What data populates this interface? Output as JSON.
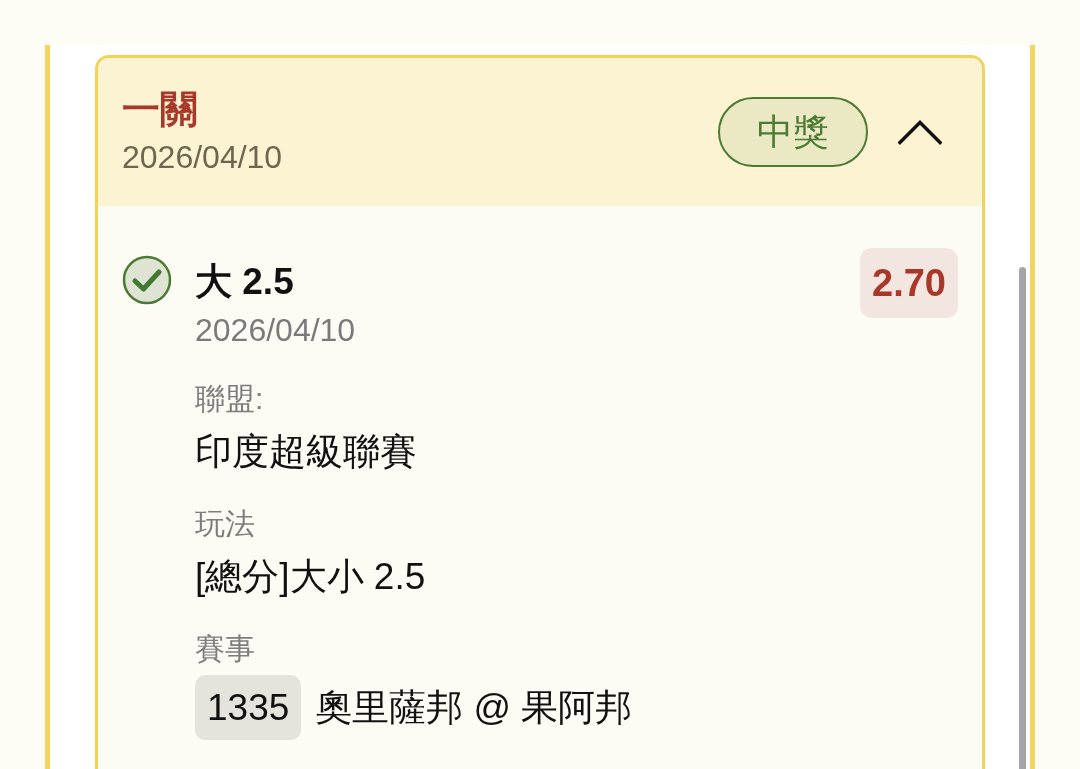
{
  "bet_card": {
    "title": "一關",
    "date": "2026/04/10",
    "status": "中獎",
    "expanded": true,
    "selections": [
      {
        "won": true,
        "pick": "大 2.5",
        "date": "2026/04/10",
        "odds": "2.70",
        "fields": [
          {
            "kind": "text",
            "label": "聯盟:",
            "value": "印度超級聯賽"
          },
          {
            "kind": "text",
            "label": "玩法",
            "value": "[總分]大小 2.5"
          },
          {
            "kind": "match",
            "label": "賽事",
            "event_number": "1335",
            "value": "奧里薩邦 @ 果阿邦"
          }
        ]
      }
    ]
  }
}
